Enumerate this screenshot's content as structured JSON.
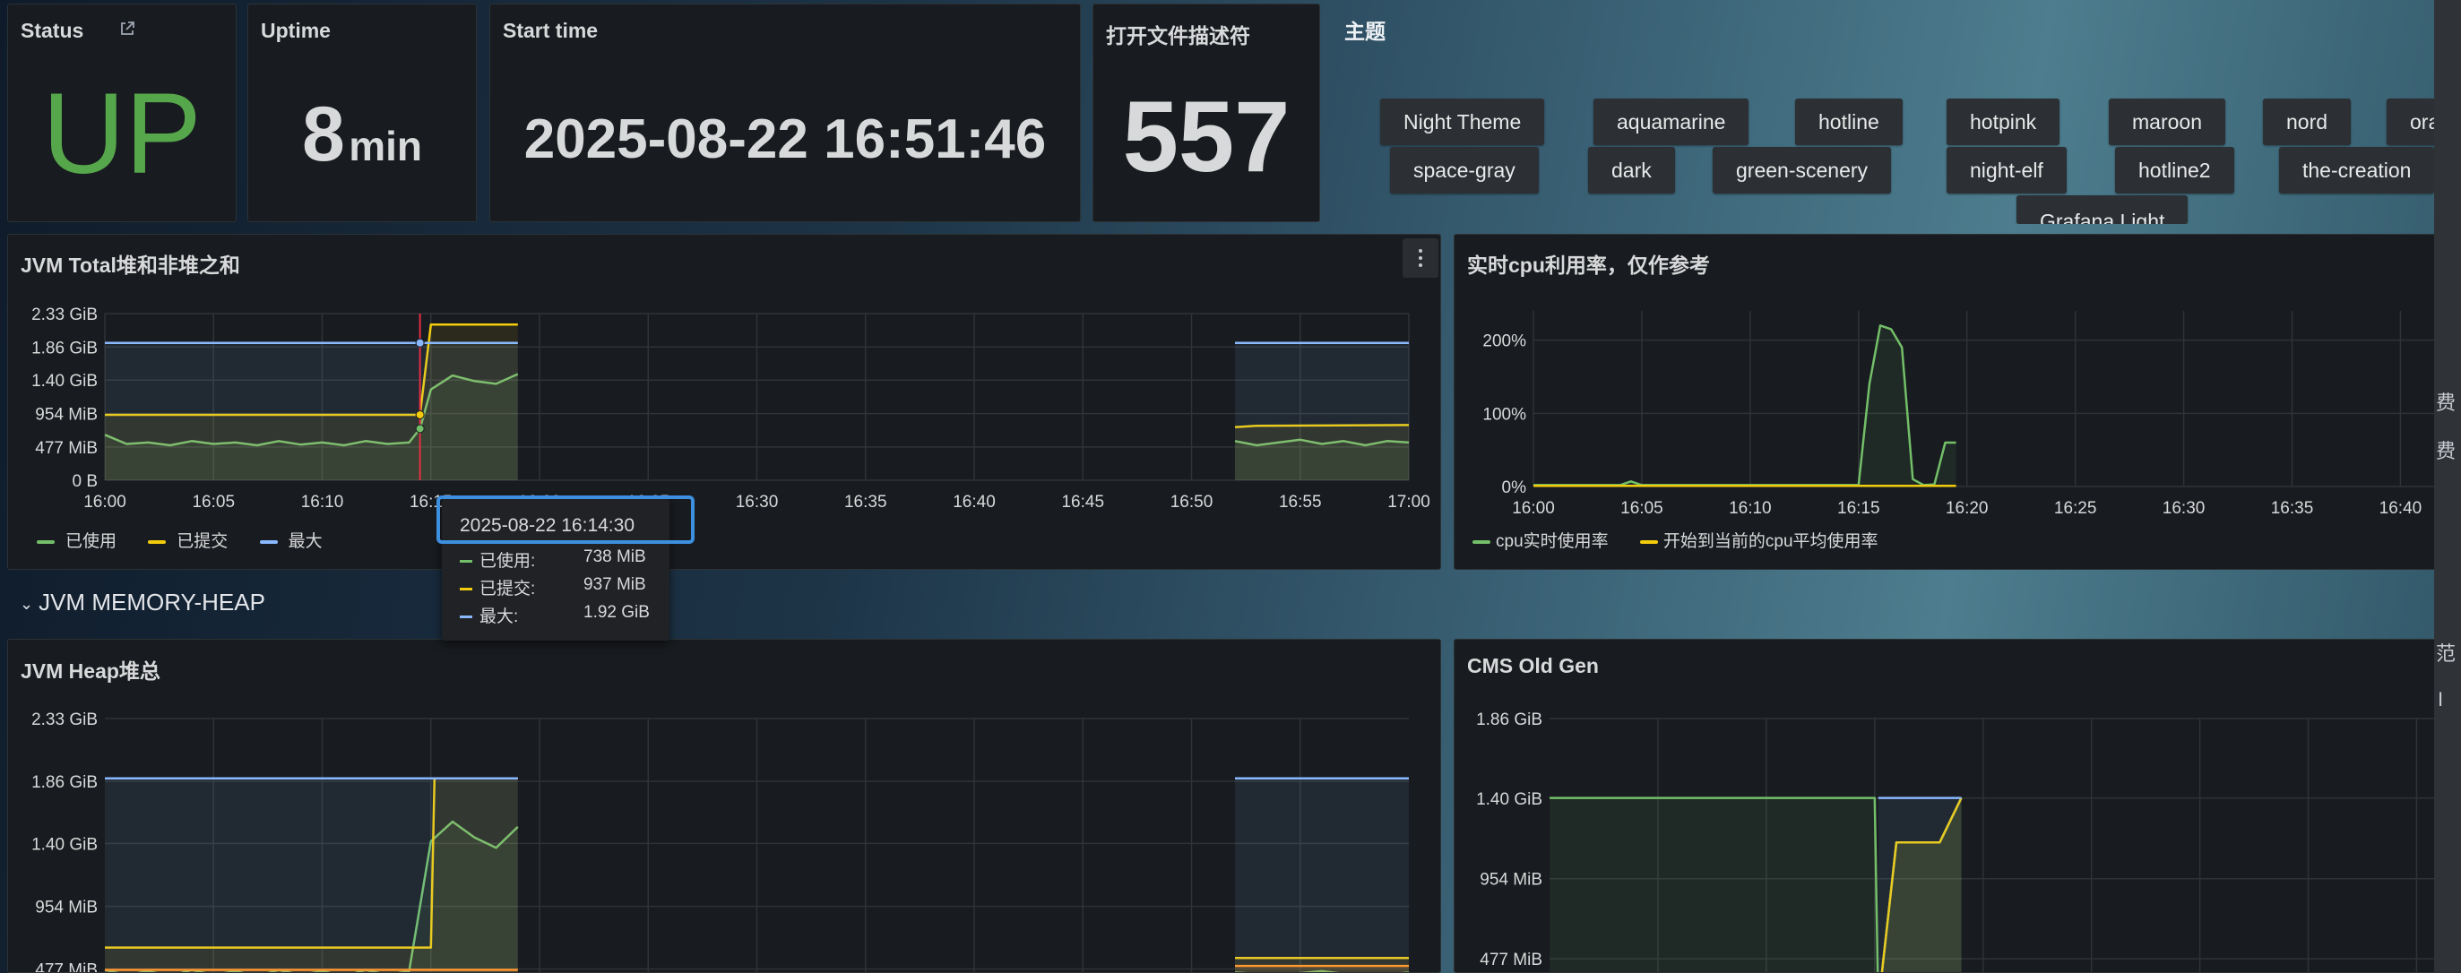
{
  "stat_panels": {
    "status": {
      "title": "Status",
      "value": "UP",
      "color": "#56a64b"
    },
    "uptime": {
      "title": "Uptime",
      "value": "8",
      "unit": "min"
    },
    "start_time": {
      "title": "Start time",
      "value": "2025-08-22 16:51:46"
    },
    "open_fd": {
      "title": "打开文件描述符",
      "value": "557"
    }
  },
  "themes": {
    "title": "主题",
    "buttons": [
      "Night Theme",
      "aquamarine",
      "hotline",
      "hotpink",
      "maroon",
      "nord",
      "ora",
      "space-gray",
      "dark",
      "green-scenery",
      "night-elf",
      "hotline2",
      "the-creation",
      "Grafana Light"
    ]
  },
  "jvm_total": {
    "title": "JVM Total堆和非堆之和",
    "chart_data": {
      "type": "line",
      "title": "JVM Total堆和非堆之和",
      "y_ticks": [
        "2.33 GiB",
        "1.86 GiB",
        "1.40 GiB",
        "954 MiB",
        "477 MiB",
        "0 B"
      ],
      "x_ticks": [
        "16:00",
        "16:05",
        "16:10",
        "16:15",
        "16:20",
        "16:25",
        "16:30",
        "16:35",
        "16:40",
        "16:45",
        "16:50",
        "16:55",
        "17:00"
      ],
      "ylim_mib": [
        0,
        2386
      ],
      "series": [
        {
          "name": "已使用",
          "color": "#73bf69",
          "unit": "MiB",
          "segments": [
            {
              "x": [
                "16:00",
                "16:01",
                "16:02",
                "16:03",
                "16:04",
                "16:05",
                "16:06",
                "16:07",
                "16:08",
                "16:09",
                "16:10",
                "16:11",
                "16:12",
                "16:13",
                "16:14",
                "16:14:30",
                "16:15",
                "16:16",
                "16:17",
                "16:18",
                "16:19"
              ],
              "y": [
                650,
                520,
                540,
                500,
                560,
                520,
                540,
                500,
                560,
                510,
                540,
                500,
                560,
                520,
                540,
                738,
                1300,
                1500,
                1420,
                1380,
                1520
              ]
            },
            {
              "x": [
                "16:52",
                "16:53",
                "16:54",
                "16:55",
                "16:56",
                "16:57",
                "16:58",
                "16:59",
                "17:00"
              ],
              "y": [
                560,
                500,
                540,
                580,
                520,
                560,
                500,
                560,
                540
              ]
            }
          ]
        },
        {
          "name": "已提交",
          "color": "#f2cc0c",
          "unit": "MiB",
          "segments": [
            {
              "x": [
                "16:00",
                "16:14:30",
                "16:15",
                "16:19"
              ],
              "y": [
                937,
                937,
                2230,
                2230
              ]
            },
            {
              "x": [
                "16:52",
                "16:53",
                "17:00"
              ],
              "y": [
                760,
                780,
                790
              ]
            }
          ]
        },
        {
          "name": "最大",
          "color": "#8ab8ff",
          "unit": "MiB",
          "segments": [
            {
              "x": [
                "16:00",
                "16:19"
              ],
              "y": [
                1966,
                1966
              ]
            },
            {
              "x": [
                "16:52",
                "17:00"
              ],
              "y": [
                1966,
                1966
              ]
            }
          ]
        }
      ],
      "legend": [
        "已使用",
        "已提交",
        "最大"
      ],
      "legend_position": "bottom-left",
      "grid": true
    },
    "tooltip": {
      "time": "2025-08-22 16:14:30",
      "rows": [
        {
          "label": "已使用:",
          "value": "738 MiB",
          "color": "#73bf69"
        },
        {
          "label": "已提交:",
          "value": "937 MiB",
          "color": "#f2cc0c"
        },
        {
          "label": "最大:",
          "value": "1.92 GiB",
          "color": "#8ab8ff"
        }
      ]
    }
  },
  "cpu": {
    "title": "实时cpu利用率，仅作参考",
    "chart_data": {
      "type": "line",
      "title": "实时cpu利用率，仅作参考",
      "y_ticks": [
        "200%",
        "100%",
        "0%"
      ],
      "x_ticks": [
        "16:00",
        "16:05",
        "16:10",
        "16:15",
        "16:20",
        "16:25",
        "16:30",
        "16:35",
        "16:40"
      ],
      "ylim_pct": [
        0,
        240
      ],
      "series": [
        {
          "name": "cpu实时使用率",
          "color": "#73bf69",
          "x": [
            "16:00",
            "16:04",
            "16:04:30",
            "16:05",
            "16:15",
            "16:15:30",
            "16:16",
            "16:16:30",
            "16:17",
            "16:17:30",
            "16:18",
            "16:18:30",
            "16:19",
            "16:19:30"
          ],
          "y": [
            2,
            2,
            7,
            2,
            2,
            140,
            220,
            215,
            190,
            10,
            2,
            3,
            60,
            60
          ]
        },
        {
          "name": "开始到当前的cpu平均使用率",
          "color": "#f2cc0c",
          "x": [
            "16:00",
            "16:19:30"
          ],
          "y": [
            1,
            1
          ]
        }
      ],
      "legend": [
        "cpu实时使用率",
        "开始到当前的cpu平均使用率"
      ],
      "legend_position": "bottom-left",
      "grid": true
    }
  },
  "row": {
    "title": "JVM MEMORY-HEAP",
    "chevron": "chevron-down-icon"
  },
  "jvm_heap": {
    "title": "JVM Heap堆总",
    "chart_data": {
      "type": "line",
      "title": "JVM Heap堆总",
      "y_ticks": [
        "2.33 GiB",
        "1.86 GiB",
        "1.40 GiB",
        "954 MiB",
        "477 MiB"
      ],
      "ylim_mib": [
        200,
        2386
      ],
      "series": [
        {
          "name": "已使用",
          "color": "#73bf69",
          "segments": [
            {
              "x": [
                "16:00",
                "16:01",
                "16:02",
                "16:03",
                "16:04",
                "16:05",
                "16:06",
                "16:07",
                "16:08",
                "16:09",
                "16:10",
                "16:11",
                "16:12",
                "16:13",
                "16:14",
                "16:15",
                "16:16",
                "16:17",
                "16:18",
                "16:19"
              ],
              "y": [
                470,
                430,
                460,
                420,
                470,
                430,
                460,
                420,
                470,
                430,
                460,
                420,
                470,
                430,
                460,
                1450,
                1600,
                1480,
                1400,
                1560
              ]
            },
            {
              "x": [
                "16:52",
                "16:54",
                "16:56",
                "16:58",
                "17:00"
              ],
              "y": [
                450,
                430,
                460,
                420,
                450
              ]
            }
          ]
        },
        {
          "name": "已提交",
          "color": "#f2cc0c",
          "segments": [
            {
              "x": [
                "16:00",
                "16:15",
                "16:15:10",
                "16:19"
              ],
              "y": [
                640,
                640,
                1930,
                1930
              ]
            },
            {
              "x": [
                "16:52",
                "17:00"
              ],
              "y": [
                560,
                560
              ]
            }
          ]
        },
        {
          "name": "最大",
          "color": "#8ab8ff",
          "segments": [
            {
              "x": [
                "16:00",
                "16:19"
              ],
              "y": [
                1930,
                1930
              ]
            },
            {
              "x": [
                "16:52",
                "17:00"
              ],
              "y": [
                1930,
                1930
              ]
            }
          ]
        },
        {
          "name": "",
          "color": "#ff9830",
          "segments": [
            {
              "x": [
                "16:00",
                "16:19"
              ],
              "y": [
                470,
                470
              ]
            },
            {
              "x": [
                "16:52",
                "17:00"
              ],
              "y": [
                500,
                500
              ]
            }
          ]
        }
      ],
      "grid": true
    }
  },
  "cms_old_gen": {
    "title": "CMS Old Gen",
    "chart_data": {
      "type": "line",
      "title": "CMS Old Gen",
      "y_ticks": [
        "1.86 GiB",
        "1.40 GiB",
        "954 MiB",
        "477 MiB"
      ],
      "ylim_mib": [
        200,
        1908
      ],
      "series": [
        {
          "name": "",
          "color": "#73bf69",
          "x": [
            "16:00",
            "16:15",
            "16:15:10",
            "16:16",
            "16:18",
            "16:19"
          ],
          "y": [
            1435,
            1435,
            200,
            1170,
            1170,
            1435
          ]
        },
        {
          "name": "",
          "color": "#f2cc0c",
          "x": [
            "16:15:10",
            "16:16",
            "16:18",
            "16:19"
          ],
          "y": [
            200,
            1170,
            1170,
            1435
          ]
        },
        {
          "name": "",
          "color": "#8ab8ff",
          "x": [
            "16:15:10",
            "16:19"
          ],
          "y": [
            1435,
            1435
          ]
        }
      ],
      "grid": true
    }
  },
  "edge_fragments": [
    "费",
    "费",
    "范",
    "I"
  ]
}
